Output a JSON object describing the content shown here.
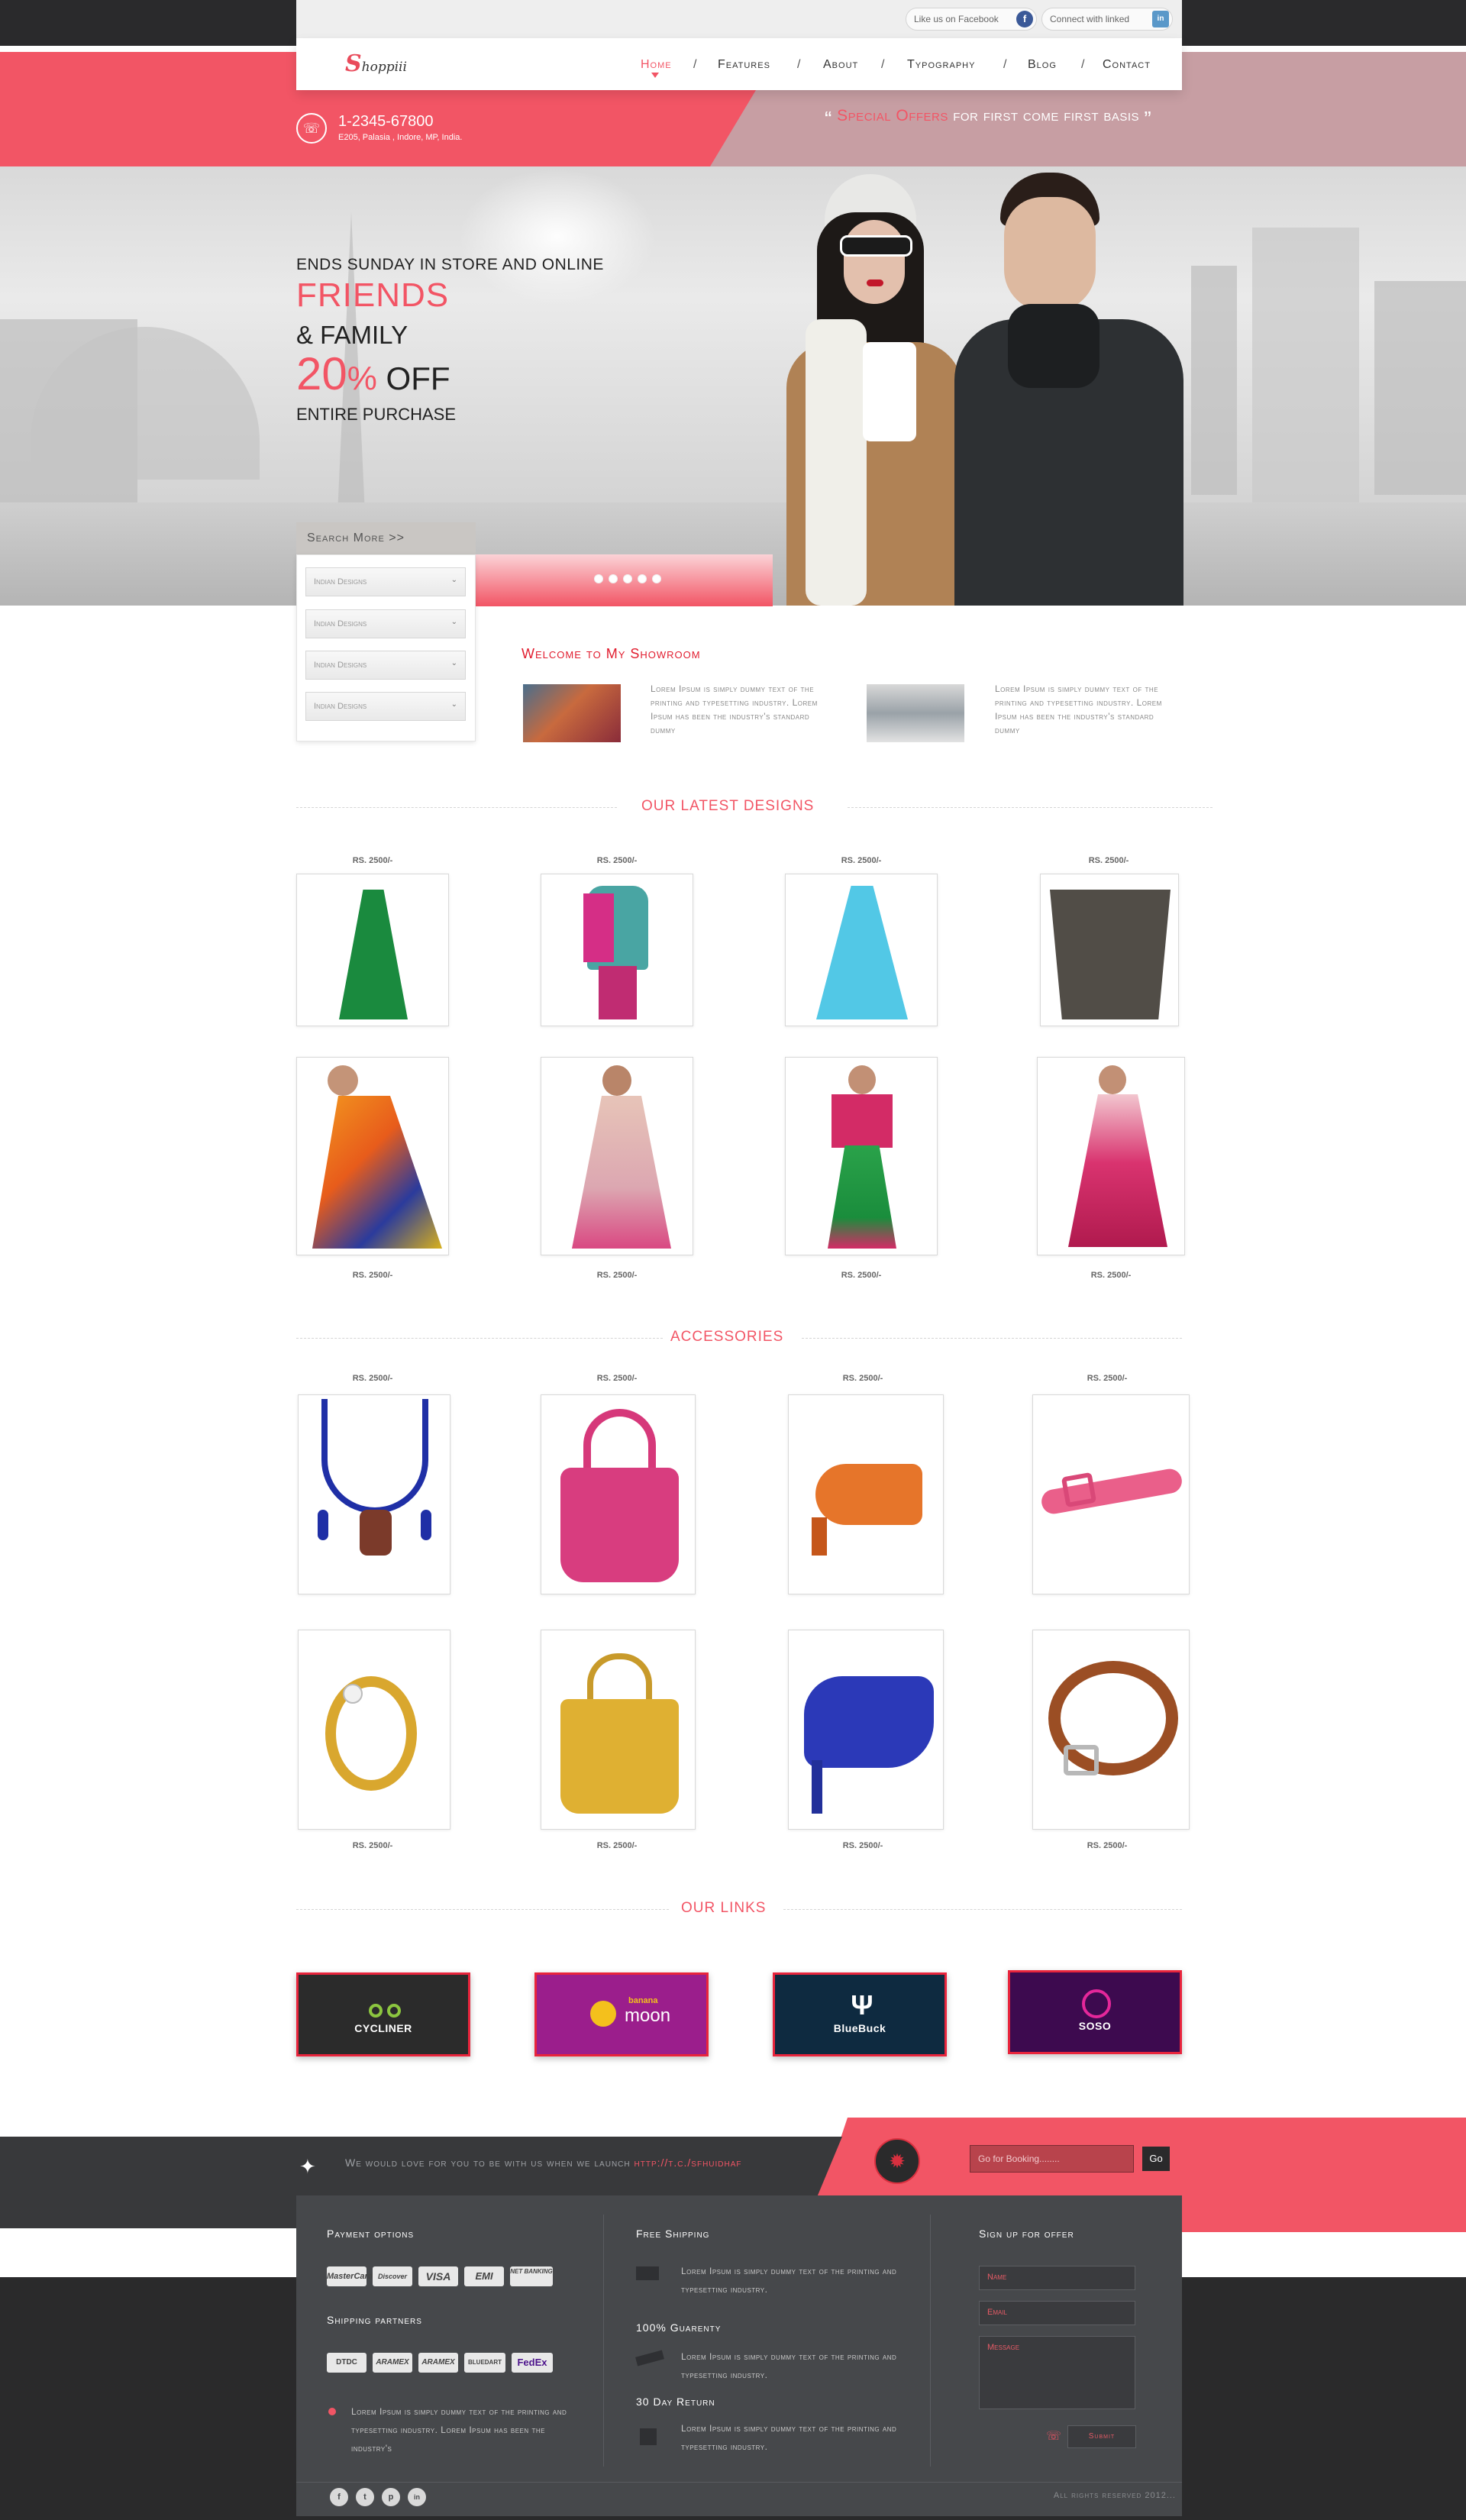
{
  "social": {
    "facebook_label": "Like us on Facebook",
    "linkedin_label": "Connect with linked",
    "facebook_icon": "f",
    "linkedin_icon": "in"
  },
  "brand": {
    "logo_initial": "S",
    "logo_rest": "hoppiii"
  },
  "nav": {
    "items": [
      "Home",
      "Features",
      "About",
      "Typography",
      "Blog",
      "Contact"
    ],
    "separator": "/"
  },
  "contact": {
    "phone": "1-2345-67800",
    "address": "E205, Palasia , Indore, MP, India."
  },
  "offer": {
    "open_quote": "“",
    "highlight": "Special Offers",
    "rest": " for first come first basis",
    "close_quote": "”"
  },
  "hero": {
    "line1": "ENDS SUNDAY IN STORE AND ONLINE",
    "line2": "FRIENDS",
    "line3": "& FAMILY",
    "line4_num": "20",
    "line4_pct": "%",
    "line4_off": " OFF",
    "line5": "ENTIRE PURCHASE",
    "slide_count": 5
  },
  "search": {
    "heading": "Search More >>",
    "selects": [
      "Indian Designs",
      "Indian Designs",
      "Indian Designs",
      "Indian Designs"
    ]
  },
  "welcome": {
    "title": "Welcome to My Showroom",
    "items": [
      "Lorem Ipsum is simply dummy text of the printing and typesetting industry. Lorem Ipsum has been the industry's standard dummy",
      "Lorem Ipsum is simply dummy text of the printing and typesetting industry. Lorem Ipsum has been the industry's standard dummy"
    ]
  },
  "latest": {
    "title": "OUR LATEST DESIGNS",
    "row1_prices": [
      "RS. 2500/-",
      "RS. 2500/-",
      "RS. 2500/-",
      "RS. 2500/-"
    ],
    "row2_prices": [
      "RS. 2500/-",
      "RS. 2500/-",
      "RS. 2500/-",
      "RS. 2500/-"
    ]
  },
  "accessories": {
    "title": "ACCESSORIES",
    "row1_prices": [
      "RS. 2500/-",
      "RS. 2500/-",
      "RS. 2500/-",
      "RS. 2500/-"
    ],
    "row2_prices": [
      "RS. 2500/-",
      "RS. 2500/-",
      "RS. 2500/-",
      "RS. 2500/-"
    ]
  },
  "links": {
    "title": "OUR LINKS",
    "cards": [
      {
        "name": "CYCLINER",
        "bg": "#2b2b2b"
      },
      {
        "name": "moon",
        "sub": "banana",
        "bg": "#9b1e8c"
      },
      {
        "name": "BlueBuck",
        "bg": "#0e2a40"
      },
      {
        "name": "SOSO",
        "bg": "#3d0a4f"
      }
    ]
  },
  "footer": {
    "tweet": "We would love for you to be with us when we launch",
    "tweet_link": "http://t.c./sfhuidhaf",
    "booking_placeholder": "Go for Booking........",
    "go_label": "Go",
    "payment_title": "Payment options",
    "payment_cards": [
      "MasterCard",
      "Discover",
      "VISA",
      "EMI",
      "NET BANKING"
    ],
    "shipping_title": "Shipping partners",
    "shipping_partners": [
      "DTDC",
      "ARAMEX",
      "ARAMEX",
      "BLUEDART",
      "FedEx"
    ],
    "lorem": "Lorem Ipsum is simply dummy text of the printing and typesetting industry. Lorem Ipsum has been the industry's",
    "free_shipping_title": "Free Shipping",
    "free_shipping_text": "Lorem Ipsum is simply dummy text of the printing and typesetting industry.",
    "guarantee_title": "100% Guarenty",
    "guarantee_text": "Lorem Ipsum is simply dummy text of the printing and typesetting industry.",
    "return_title": "30 Day Return",
    "return_text": "Lorem Ipsum is simply dummy text of the printing and typesetting industry.",
    "signup_title": "Sign up for offer",
    "name_placeholder": "Name",
    "email_placeholder": "Email",
    "message_placeholder": "Message",
    "submit_label": "Submit",
    "copyright": "All rights reserved 2012...",
    "social_icons": [
      "f",
      "t",
      "p",
      "in"
    ]
  },
  "colors": {
    "accent": "#f25565",
    "dark": "#2a2a2c",
    "panel": "#46484b"
  }
}
